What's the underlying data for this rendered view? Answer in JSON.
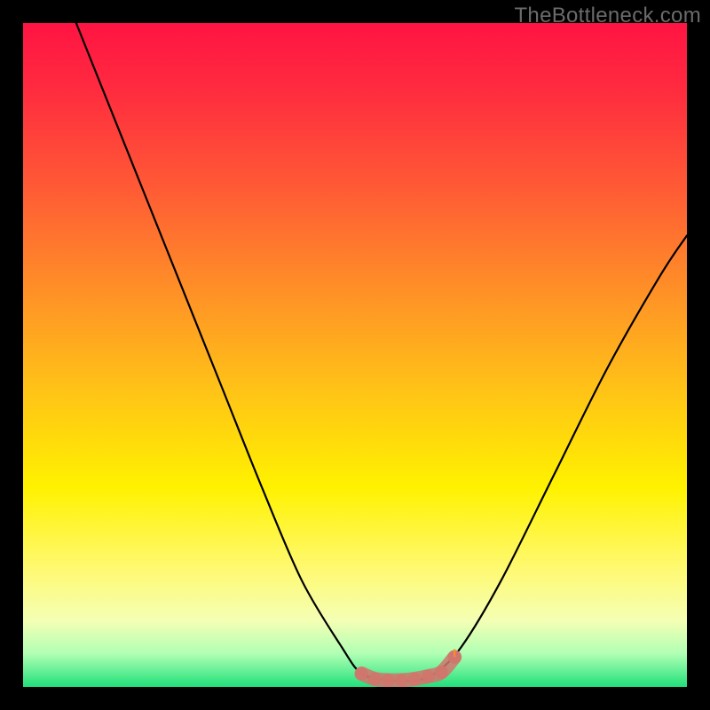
{
  "watermark": "TheBottleneck.com",
  "chart_data": {
    "type": "line",
    "title": "",
    "xlabel": "",
    "ylabel": "",
    "xlim": [
      0,
      100
    ],
    "ylim": [
      0,
      100
    ],
    "grid": false,
    "curve": [
      {
        "x": 8.0,
        "y": 100.0
      },
      {
        "x": 12.0,
        "y": 90.0
      },
      {
        "x": 18.0,
        "y": 75.0
      },
      {
        "x": 24.0,
        "y": 60.0
      },
      {
        "x": 30.0,
        "y": 45.0
      },
      {
        "x": 36.0,
        "y": 30.0
      },
      {
        "x": 42.0,
        "y": 16.0
      },
      {
        "x": 48.0,
        "y": 6.0
      },
      {
        "x": 51.0,
        "y": 2.0
      },
      {
        "x": 55.0,
        "y": 1.0
      },
      {
        "x": 59.0,
        "y": 1.0
      },
      {
        "x": 62.0,
        "y": 2.0
      },
      {
        "x": 66.0,
        "y": 6.0
      },
      {
        "x": 72.0,
        "y": 16.0
      },
      {
        "x": 80.0,
        "y": 32.0
      },
      {
        "x": 88.0,
        "y": 48.0
      },
      {
        "x": 96.0,
        "y": 62.0
      },
      {
        "x": 100.0,
        "y": 68.0
      }
    ],
    "highlight_segment": [
      {
        "x": 51.0,
        "y": 2.0
      },
      {
        "x": 53.0,
        "y": 1.2
      },
      {
        "x": 55.0,
        "y": 1.0
      },
      {
        "x": 57.0,
        "y": 1.0
      },
      {
        "x": 59.0,
        "y": 1.2
      },
      {
        "x": 61.0,
        "y": 1.6
      },
      {
        "x": 63.0,
        "y": 2.2
      },
      {
        "x": 65.0,
        "y": 4.5
      }
    ],
    "background_gradient": {
      "stops": [
        {
          "offset": 0.0,
          "color": "#ff1443"
        },
        {
          "offset": 0.1,
          "color": "#ff2b3f"
        },
        {
          "offset": 0.25,
          "color": "#ff5b35"
        },
        {
          "offset": 0.4,
          "color": "#ff8f27"
        },
        {
          "offset": 0.55,
          "color": "#ffc217"
        },
        {
          "offset": 0.7,
          "color": "#fff200"
        },
        {
          "offset": 0.82,
          "color": "#fff970"
        },
        {
          "offset": 0.9,
          "color": "#f4ffb4"
        },
        {
          "offset": 0.95,
          "color": "#b0ffb4"
        },
        {
          "offset": 1.0,
          "color": "#21e07a"
        }
      ]
    },
    "colors": {
      "curve": "#000000",
      "highlight": "#d0766d",
      "tick": "#000000"
    }
  }
}
